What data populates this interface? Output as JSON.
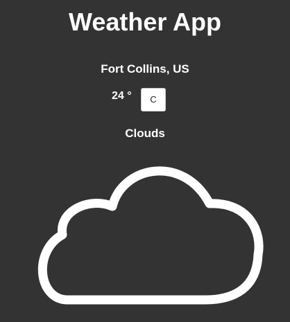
{
  "header": {
    "title": "Weather App"
  },
  "weather": {
    "location": "Fort Collins, US",
    "temperature": "24 °",
    "unit_button_label": "C",
    "condition": "Clouds",
    "condition_icon": "cloud-icon"
  },
  "colors": {
    "background": "#333333",
    "text": "#ffffff",
    "button_background": "#ffffff",
    "button_text": "#222222"
  }
}
